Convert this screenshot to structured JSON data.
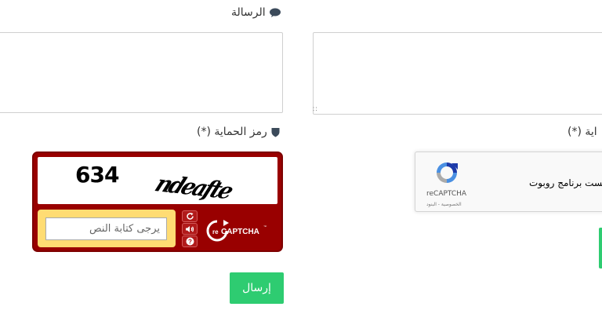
{
  "form": {
    "message_label": "الرسالة",
    "captcha_label": "رمز الحماية (*)",
    "captcha_label_right_partial": "اية (*)",
    "submit_label": "إرسال"
  },
  "recaptcha_widget": {
    "checkbox_text": "لست برنامج روبوت",
    "brand": "reCAPTCHA",
    "terms": "الخصوصية - البنود"
  },
  "legacy_captcha": {
    "challenge_text_1": "634",
    "challenge_text_2": "ndeafte",
    "input_placeholder": "يرجى كتابة النص",
    "logo_text": "CAPTCHA",
    "logo_prefix": "re",
    "help_label": "?"
  },
  "colors": {
    "submit": "#2ecc71",
    "legacy_bg": "#990000",
    "legacy_input_frame": "#ffdc73"
  },
  "icons": {
    "message": "comment-icon",
    "shield": "shield-icon",
    "refresh": "refresh-icon",
    "audio": "audio-icon",
    "help": "help-icon"
  }
}
